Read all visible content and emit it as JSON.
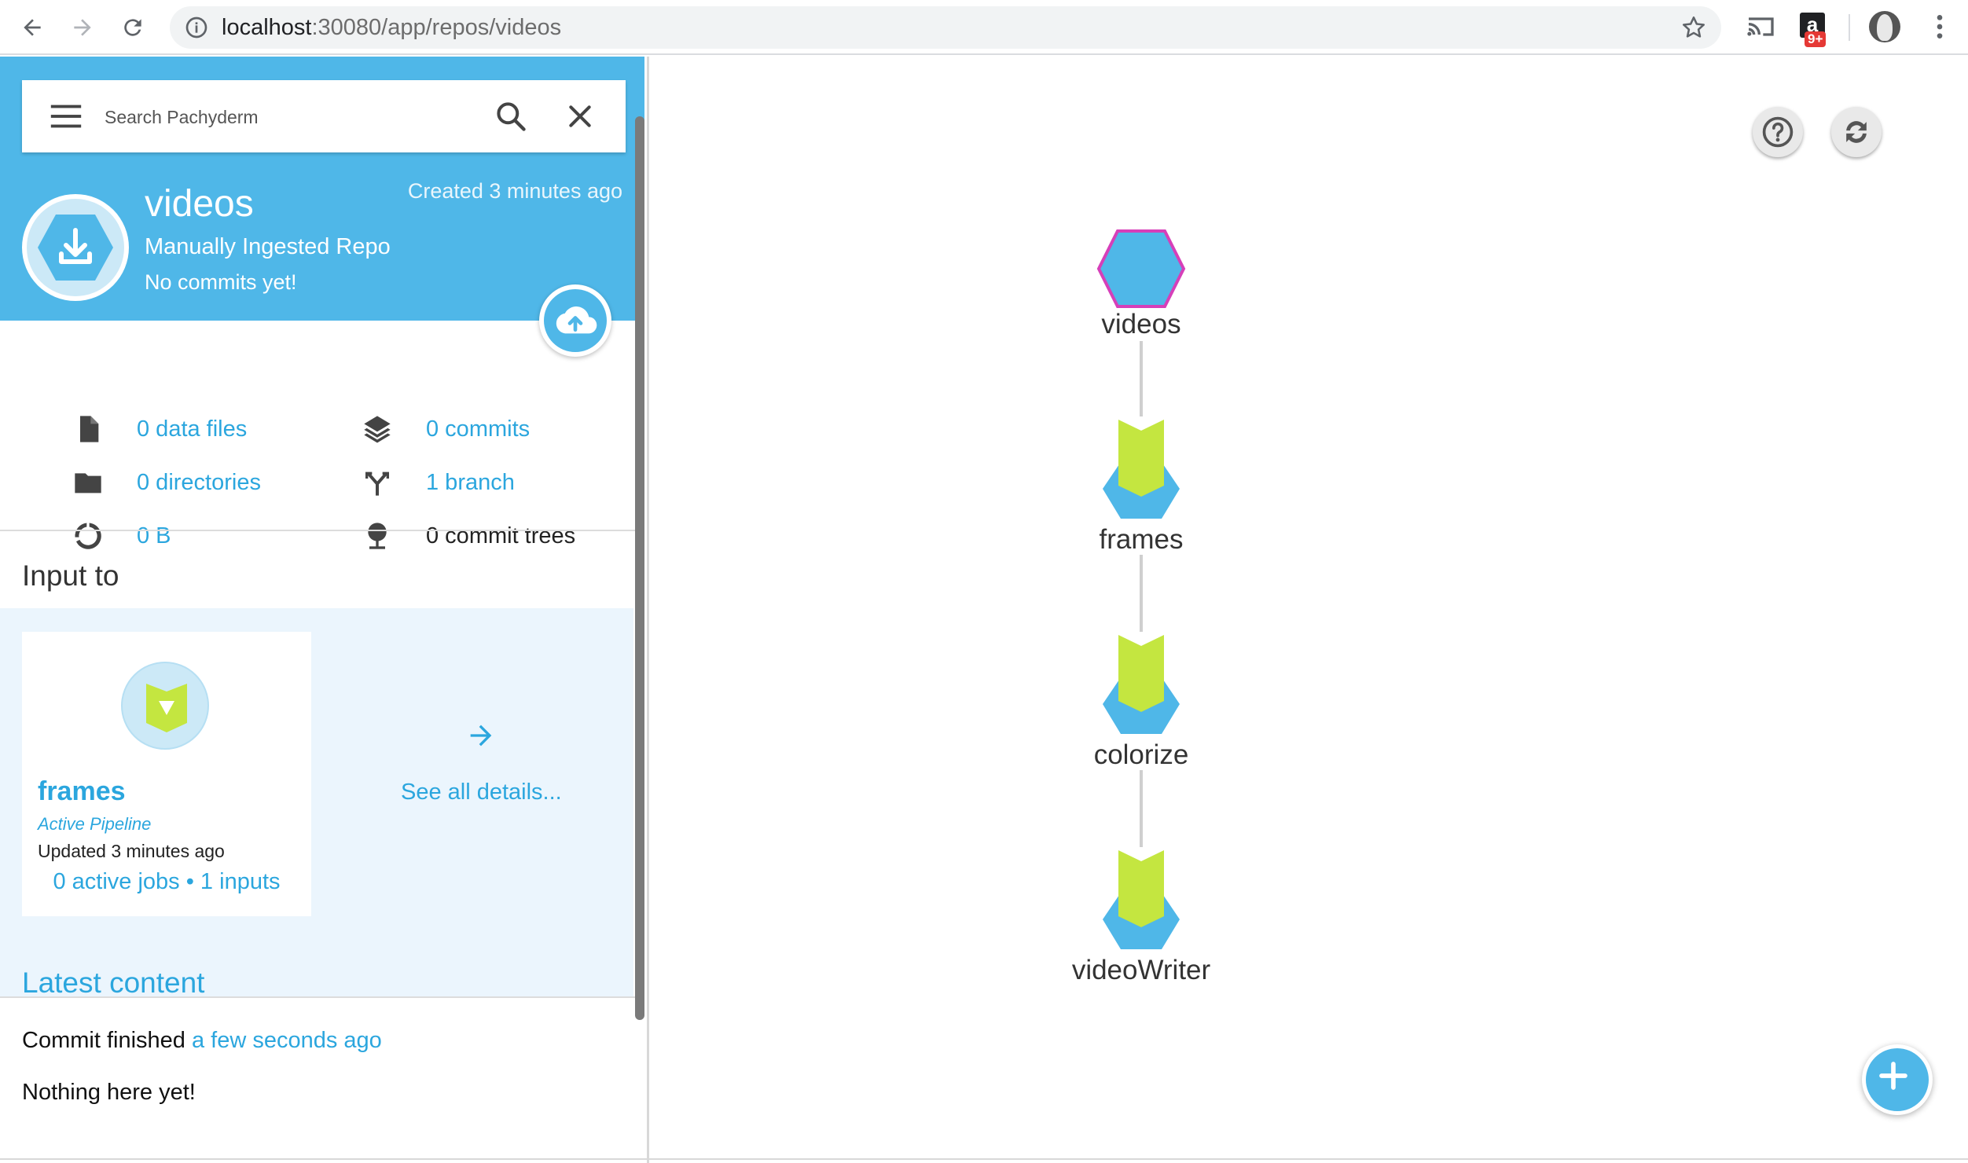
{
  "browser": {
    "url_host": "localhost",
    "url_rest": ":30080/app/repos/videos",
    "extension_count": "9+"
  },
  "search": {
    "placeholder": "Search Pachyderm"
  },
  "repo": {
    "name": "videos",
    "type": "Manually Ingested Repo",
    "commit_status": "No commits yet!",
    "created": "Created 3 minutes ago"
  },
  "stats": {
    "data_files": "0 data files",
    "commits": "0 commits",
    "directories": "0 directories",
    "branches": "1 branch",
    "size": "0 B",
    "commit_trees": "0 commit trees"
  },
  "input_to": {
    "title": "Input to",
    "pipeline": {
      "name": "frames",
      "status": "Active Pipeline",
      "updated": "Updated 3 minutes ago",
      "jobs": "0 active jobs • 1 inputs"
    },
    "see_all": "See all details..."
  },
  "latest": {
    "title": "Latest content",
    "commit_prefix": "Commit finished ",
    "commit_time": "a few seconds ago",
    "empty": "Nothing here yet!"
  },
  "dag": {
    "nodes": [
      {
        "label": "videos",
        "kind": "repo",
        "selected": true
      },
      {
        "label": "frames",
        "kind": "pipeline"
      },
      {
        "label": "colorize",
        "kind": "pipeline"
      },
      {
        "label": "videoWriter",
        "kind": "pipeline"
      }
    ]
  },
  "colors": {
    "accent": "#4fb7e8",
    "link": "#2ba6de",
    "pipeline_green": "#c4e640",
    "selected_outline": "#d63fb9"
  }
}
